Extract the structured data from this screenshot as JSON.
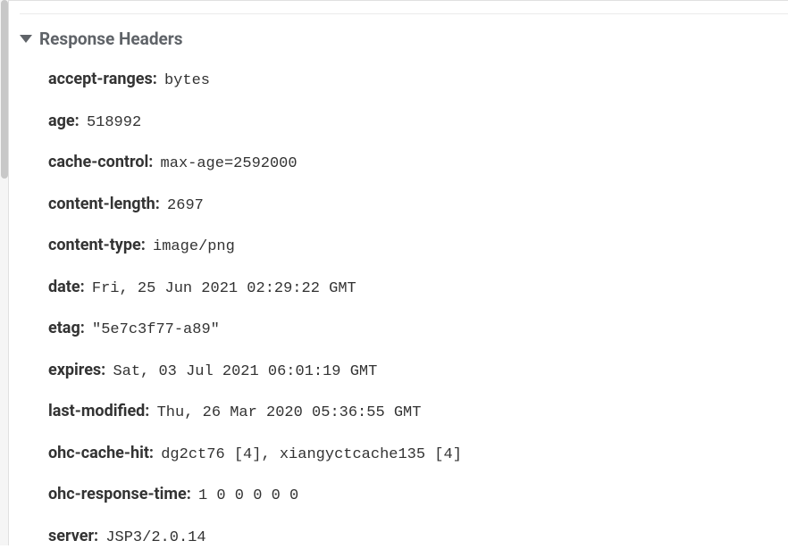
{
  "section": {
    "title": "Response Headers"
  },
  "headers": [
    {
      "name": "accept-ranges:",
      "value": "bytes"
    },
    {
      "name": "age:",
      "value": "518992"
    },
    {
      "name": "cache-control:",
      "value": "max-age=2592000"
    },
    {
      "name": "content-length:",
      "value": "2697"
    },
    {
      "name": "content-type:",
      "value": "image/png"
    },
    {
      "name": "date:",
      "value": "Fri, 25 Jun 2021 02:29:22 GMT"
    },
    {
      "name": "etag:",
      "value": "\"5e7c3f77-a89\""
    },
    {
      "name": "expires:",
      "value": "Sat, 03 Jul 2021 06:01:19 GMT"
    },
    {
      "name": "last-modified:",
      "value": "Thu, 26 Mar 2020 05:36:55 GMT"
    },
    {
      "name": "ohc-cache-hit:",
      "value": "dg2ct76 [4], xiangyctcache135 [4]"
    },
    {
      "name": "ohc-response-time:",
      "value": "1 0 0 0 0 0"
    },
    {
      "name": "server:",
      "value": "JSP3/2.0.14"
    }
  ]
}
